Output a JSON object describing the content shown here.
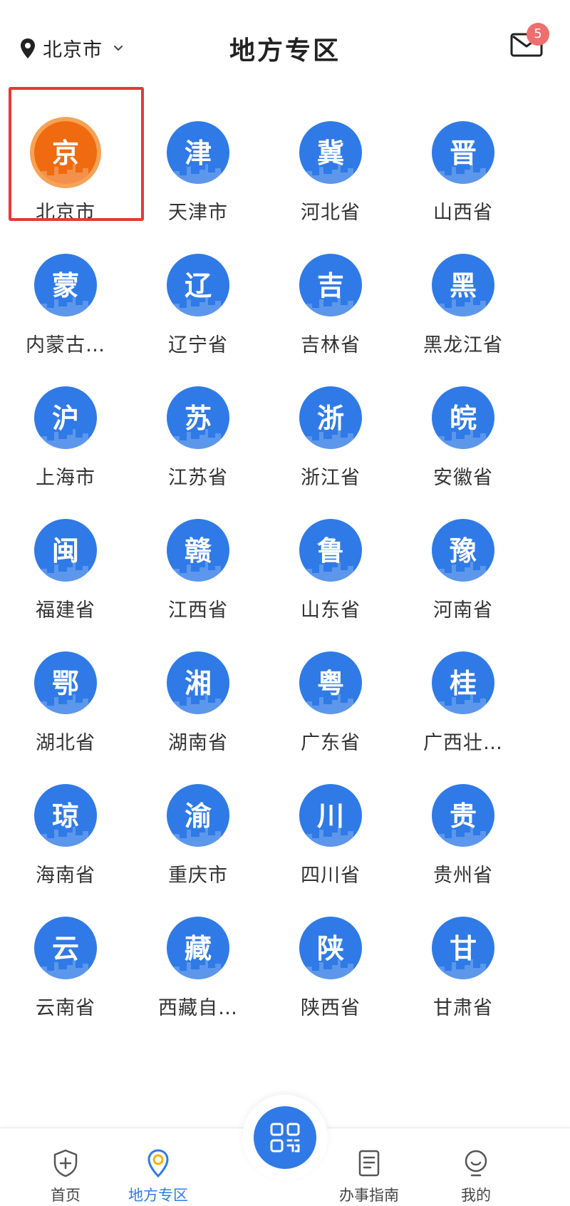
{
  "header": {
    "location": "北京市",
    "title": "地方专区",
    "mail_badge": "5"
  },
  "regions": [
    {
      "glyph": "京",
      "label": "北京市",
      "highlighted": true
    },
    {
      "glyph": "津",
      "label": "天津市"
    },
    {
      "glyph": "冀",
      "label": "河北省"
    },
    {
      "glyph": "晋",
      "label": "山西省"
    },
    {
      "glyph": "蒙",
      "label": "内蒙古…"
    },
    {
      "glyph": "辽",
      "label": "辽宁省"
    },
    {
      "glyph": "吉",
      "label": "吉林省"
    },
    {
      "glyph": "黑",
      "label": "黑龙江省"
    },
    {
      "glyph": "沪",
      "label": "上海市"
    },
    {
      "glyph": "苏",
      "label": "江苏省"
    },
    {
      "glyph": "浙",
      "label": "浙江省"
    },
    {
      "glyph": "皖",
      "label": "安徽省"
    },
    {
      "glyph": "闽",
      "label": "福建省"
    },
    {
      "glyph": "赣",
      "label": "江西省"
    },
    {
      "glyph": "鲁",
      "label": "山东省"
    },
    {
      "glyph": "豫",
      "label": "河南省"
    },
    {
      "glyph": "鄂",
      "label": "湖北省"
    },
    {
      "glyph": "湘",
      "label": "湖南省"
    },
    {
      "glyph": "粤",
      "label": "广东省"
    },
    {
      "glyph": "桂",
      "label": "广西壮…"
    },
    {
      "glyph": "琼",
      "label": "海南省"
    },
    {
      "glyph": "渝",
      "label": "重庆市"
    },
    {
      "glyph": "川",
      "label": "四川省"
    },
    {
      "glyph": "贵",
      "label": "贵州省"
    },
    {
      "glyph": "云",
      "label": "云南省"
    },
    {
      "glyph": "藏",
      "label": "西藏自…"
    },
    {
      "glyph": "陕",
      "label": "陕西省"
    },
    {
      "glyph": "甘",
      "label": "甘肃省"
    }
  ],
  "nav": {
    "home": "首页",
    "local": "地方专区",
    "guide": "办事指南",
    "mine": "我的"
  },
  "colors": {
    "accent": "#2f7ae6",
    "highlight_border": "#e53935",
    "beijing_icon": "#f06a10",
    "badge": "#f06e6e"
  }
}
